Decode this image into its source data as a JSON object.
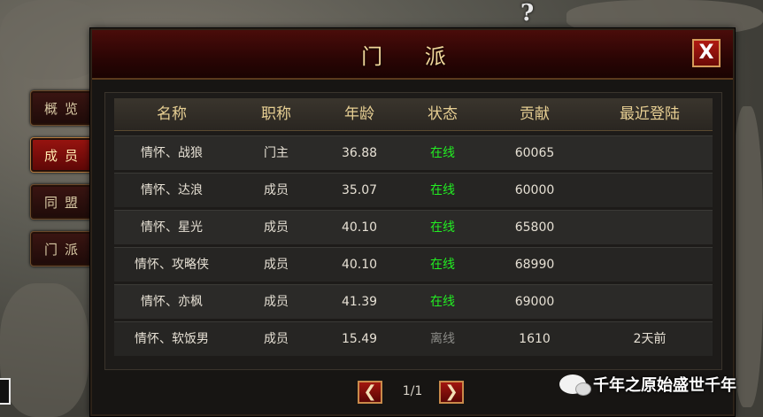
{
  "window": {
    "title": "门  派",
    "close_label": "X"
  },
  "side_tabs": [
    {
      "label": "概览",
      "active": false
    },
    {
      "label": "成员",
      "active": true
    },
    {
      "label": "同盟",
      "active": false
    },
    {
      "label": "门派",
      "active": false
    }
  ],
  "table": {
    "columns": [
      "名称",
      "职称",
      "年龄",
      "状态",
      "贡献",
      "最近登陆"
    ],
    "rows": [
      {
        "name": "情怀、战狼",
        "title": "门主",
        "age": "36.88",
        "status": "在线",
        "contribution": "60065",
        "last_login": ""
      },
      {
        "name": "情怀、达浪",
        "title": "成员",
        "age": "35.07",
        "status": "在线",
        "contribution": "60000",
        "last_login": ""
      },
      {
        "name": "情怀、星光",
        "title": "成员",
        "age": "40.10",
        "status": "在线",
        "contribution": "65800",
        "last_login": ""
      },
      {
        "name": "情怀、攻略侠",
        "title": "成员",
        "age": "40.10",
        "status": "在线",
        "contribution": "68990",
        "last_login": ""
      },
      {
        "name": "情怀、亦枫",
        "title": "成员",
        "age": "41.39",
        "status": "在线",
        "contribution": "69000",
        "last_login": ""
      },
      {
        "name": "情怀、软饭男",
        "title": "成员",
        "age": "15.49",
        "status": "离线",
        "contribution": "1610",
        "last_login": "2天前"
      }
    ]
  },
  "pager": {
    "prev_label": "❮",
    "page_text": "1/1",
    "next_label": "❯"
  },
  "watermark": {
    "text": "千年之原始盛世千年"
  },
  "background": {
    "help_glyph": "?"
  },
  "colors": {
    "online": "#22ee22",
    "offline": "#8a8a86",
    "accent_red": "#8a0f0b",
    "gold_text": "#e7cf93"
  }
}
